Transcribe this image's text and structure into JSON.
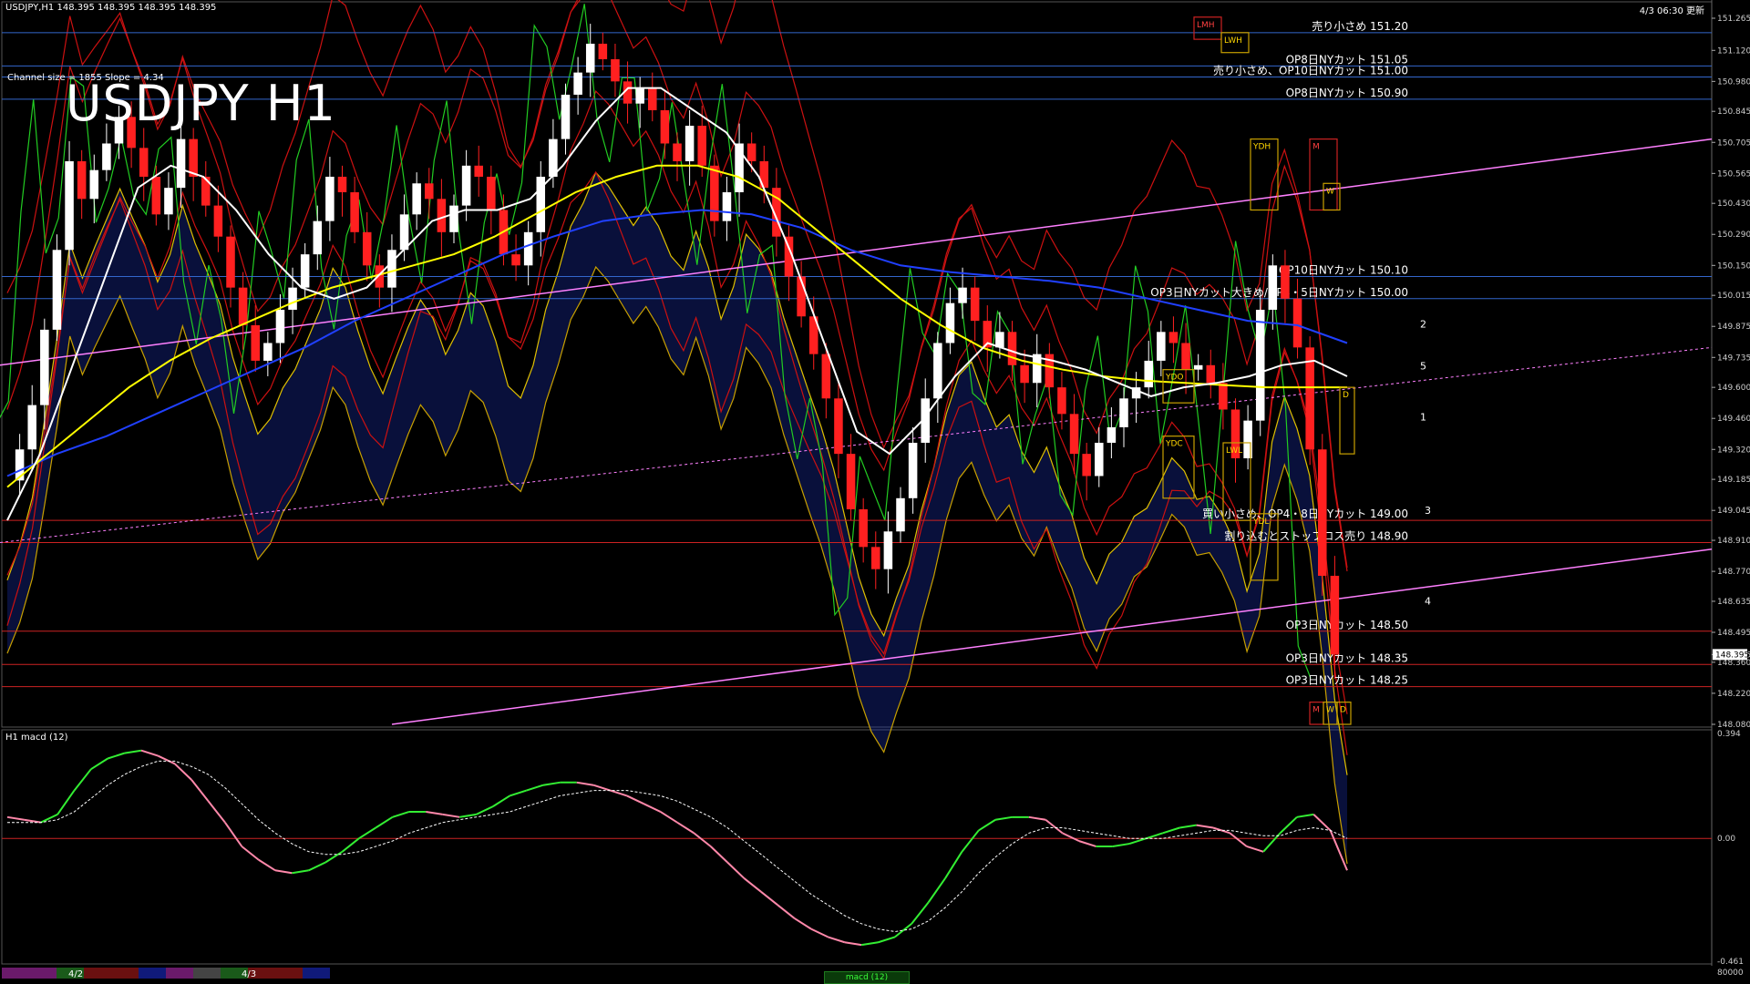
{
  "header": {
    "info": "USDJPY,H1  148.395 148.395 148.395 148.395",
    "timestamp": "4/3 06:30 更新",
    "channel": "Channel size = 1855 Slope = 4.34",
    "title": "USDJPY H1"
  },
  "colors": {
    "background": "#000000",
    "candle_up": "#ffffff",
    "candle_down": "#ff2020",
    "ma_short": "#ffffff",
    "ma_mid": "#ffff00",
    "ma_long": "#2040ff",
    "chikou": "#22cc22",
    "bollinger": "#cc1111",
    "channel": "#ff80ff",
    "cloud": "#1a2ea8",
    "level_line_red": "#cc2222",
    "level_line_blue": "#3366cc",
    "macd_rising": "#33ee33",
    "macd_falling": "#ff88aa"
  },
  "chart_data": [
    {
      "type": "candlestick",
      "symbol": "USDJPY",
      "timeframe": "H1",
      "ylim": [
        148.08,
        151.265
      ],
      "y_ticks": [
        "151.265",
        "151.120",
        "150.980",
        "150.845",
        "150.705",
        "150.565",
        "150.430",
        "150.290",
        "150.150",
        "150.015",
        "149.875",
        "149.735",
        "149.600",
        "149.460",
        "149.320",
        "149.185",
        "149.045",
        "148.910",
        "148.770",
        "148.635",
        "148.495",
        "148.395",
        "148.360",
        "148.220",
        "148.080"
      ],
      "current_price": "148.395",
      "x_labels": [
        "4/2",
        "4/3"
      ],
      "price_series": [
        149.18,
        149.32,
        149.52,
        149.86,
        150.22,
        150.62,
        150.45,
        150.58,
        150.7,
        150.82,
        150.68,
        150.55,
        150.38,
        150.5,
        150.72,
        150.55,
        150.42,
        150.28,
        150.05,
        149.88,
        149.72,
        149.8,
        149.95,
        150.05,
        150.2,
        150.35,
        150.55,
        150.48,
        150.3,
        150.15,
        150.05,
        150.22,
        150.38,
        150.52,
        150.45,
        150.3,
        150.42,
        150.6,
        150.55,
        150.4,
        150.2,
        150.15,
        150.3,
        150.55,
        150.72,
        150.92,
        151.02,
        151.15,
        151.08,
        150.98,
        150.88,
        150.95,
        150.85,
        150.7,
        150.62,
        150.78,
        150.6,
        150.35,
        150.48,
        150.7,
        150.62,
        150.5,
        150.28,
        150.1,
        149.92,
        149.75,
        149.55,
        149.3,
        149.05,
        148.88,
        148.78,
        148.95,
        149.1,
        149.35,
        149.55,
        149.8,
        149.98,
        150.05,
        149.9,
        149.78,
        149.85,
        149.7,
        149.62,
        149.75,
        149.6,
        149.48,
        149.3,
        149.2,
        149.35,
        149.42,
        149.55,
        149.6,
        149.72,
        149.85,
        149.8,
        149.68,
        149.7,
        149.62,
        149.5,
        149.28,
        149.45,
        149.95,
        150.15,
        150.0,
        149.78,
        149.32,
        148.75,
        148.395
      ],
      "ma_short": [
        149.0,
        149.3,
        149.7,
        150.1,
        150.5,
        150.6,
        150.55,
        150.4,
        150.2,
        150.05,
        150.0,
        150.05,
        150.2,
        150.35,
        150.4,
        150.4,
        150.45,
        150.6,
        150.8,
        150.95,
        150.95,
        150.85,
        150.75,
        150.55,
        150.2,
        149.8,
        149.4,
        149.3,
        149.45,
        149.65,
        149.8,
        149.75,
        149.72,
        149.68,
        149.62,
        149.56,
        149.6,
        149.62,
        149.65,
        149.7,
        149.72,
        149.65
      ],
      "ma_mid": [
        149.15,
        149.3,
        149.45,
        149.6,
        149.72,
        149.82,
        149.9,
        149.98,
        150.05,
        150.1,
        150.15,
        150.2,
        150.28,
        150.38,
        150.48,
        150.55,
        150.6,
        150.6,
        150.55,
        150.45,
        150.3,
        150.15,
        150.0,
        149.88,
        149.78,
        149.72,
        149.68,
        149.65,
        149.63,
        149.62,
        149.61,
        149.6,
        149.6,
        149.6
      ],
      "ma_long": [
        149.2,
        149.3,
        149.38,
        149.48,
        149.58,
        149.68,
        149.78,
        149.9,
        150.0,
        150.1,
        150.2,
        150.28,
        150.35,
        150.38,
        150.4,
        150.38,
        150.32,
        150.22,
        150.15,
        150.12,
        150.1,
        150.08,
        150.05,
        150.0,
        149.95,
        149.9,
        149.88,
        149.8
      ]
    },
    {
      "type": "line",
      "name": "H1 macd (12)",
      "ylim": [
        -0.461,
        0.394
      ],
      "y_ticks": [
        "0.394",
        "0.00",
        "-0.461"
      ],
      "macd": [
        0.08,
        0.07,
        0.06,
        0.09,
        0.18,
        0.26,
        0.3,
        0.32,
        0.33,
        0.31,
        0.28,
        0.22,
        0.14,
        0.06,
        -0.03,
        -0.08,
        -0.12,
        -0.13,
        -0.12,
        -0.09,
        -0.05,
        0.0,
        0.04,
        0.08,
        0.1,
        0.1,
        0.09,
        0.08,
        0.09,
        0.12,
        0.16,
        0.18,
        0.2,
        0.21,
        0.21,
        0.2,
        0.18,
        0.16,
        0.13,
        0.1,
        0.06,
        0.02,
        -0.03,
        -0.09,
        -0.15,
        -0.2,
        -0.25,
        -0.3,
        -0.34,
        -0.37,
        -0.39,
        -0.4,
        -0.39,
        -0.37,
        -0.32,
        -0.24,
        -0.15,
        -0.05,
        0.03,
        0.07,
        0.08,
        0.08,
        0.07,
        0.02,
        -0.01,
        -0.03,
        -0.03,
        -0.02,
        0.0,
        0.02,
        0.04,
        0.05,
        0.04,
        0.02,
        -0.03,
        -0.05,
        0.02,
        0.08,
        0.09,
        0.03,
        -0.12
      ],
      "signal": [
        0.06,
        0.06,
        0.06,
        0.07,
        0.1,
        0.15,
        0.2,
        0.24,
        0.27,
        0.29,
        0.29,
        0.27,
        0.24,
        0.19,
        0.13,
        0.07,
        0.02,
        -0.02,
        -0.05,
        -0.06,
        -0.06,
        -0.05,
        -0.03,
        -0.01,
        0.02,
        0.04,
        0.06,
        0.07,
        0.08,
        0.09,
        0.1,
        0.12,
        0.14,
        0.16,
        0.17,
        0.18,
        0.18,
        0.18,
        0.17,
        0.16,
        0.14,
        0.11,
        0.08,
        0.04,
        -0.01,
        -0.06,
        -0.11,
        -0.16,
        -0.21,
        -0.25,
        -0.29,
        -0.32,
        -0.34,
        -0.35,
        -0.34,
        -0.31,
        -0.26,
        -0.2,
        -0.13,
        -0.07,
        -0.02,
        0.02,
        0.04,
        0.04,
        0.03,
        0.02,
        0.01,
        0.0,
        0.0,
        0.0,
        0.01,
        0.02,
        0.03,
        0.03,
        0.02,
        0.01,
        0.01,
        0.03,
        0.04,
        0.03,
        0.0
      ]
    }
  ],
  "levels": [
    {
      "label": "売り小さめ 151.20",
      "price": 151.2,
      "color": "#3366cc"
    },
    {
      "label": "OP8日NYカット 151.05",
      "price": 151.05,
      "color": "#3366cc"
    },
    {
      "label": "売り小さめ、OP10日NYカット 151.00",
      "price": 151.0,
      "color": "#3366cc"
    },
    {
      "label": "OP8日NYカット 150.90",
      "price": 150.9,
      "color": "#3366cc"
    },
    {
      "label": "OP10日NYカット 150.10",
      "price": 150.1,
      "color": "#3366cc"
    },
    {
      "label": "OP3日NYカット大きめ/OP4・5日NYカット 150.00",
      "price": 150.0,
      "color": "#3366cc"
    },
    {
      "label": "買い小さめ、OP4・8日NYカット 149.00",
      "price": 149.0,
      "color": "#cc2222"
    },
    {
      "label": "割り込むとストップロス売り 148.90",
      "price": 148.9,
      "color": "#cc2222"
    },
    {
      "label": "OP3日NYカット 148.50",
      "price": 148.5,
      "color": "#cc2222"
    },
    {
      "label": "OP3日NYカット 148.35",
      "price": 148.35,
      "color": "#cc2222"
    },
    {
      "label": "OP3日NYカット 148.25",
      "price": 148.25,
      "color": "#cc2222"
    }
  ],
  "box_labels": {
    "lmh": "LMH",
    "lwh": "LWH",
    "ydh": "YDH",
    "yd": "YD",
    "ydo": "YDO",
    "ydc": "YDC",
    "ydl": "YDL",
    "lwl": "LWL",
    "d": "D",
    "m": "M",
    "w": "W"
  },
  "channel_labels": [
    "2",
    "5",
    "1",
    "3",
    "4"
  ],
  "macd_panel": {
    "label": "H1 macd (12)",
    "scale_bottom": "80000",
    "tab_label": "macd (12)"
  }
}
